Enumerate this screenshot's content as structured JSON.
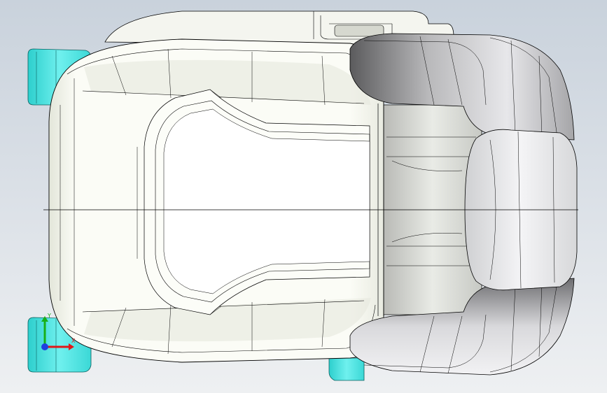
{
  "viewport": {
    "background_top": "#c9d2dc",
    "background_bottom": "#eef0f2"
  },
  "model": {
    "shell_color": "#f2f3ec",
    "shade_color": "#c8cbbf",
    "bolster_color": "#9a9a9c",
    "bracket_color": "#49e2e0",
    "edge_color": "#000000"
  },
  "triad": {
    "x_label": "X",
    "y_label": "Y",
    "x_color": "#e01818",
    "y_color": "#18b018",
    "z_color": "#2040e0"
  }
}
